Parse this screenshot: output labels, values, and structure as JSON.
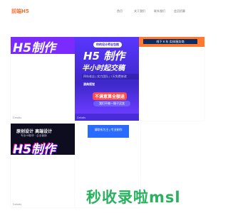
{
  "header": {
    "logo": "前端H5",
    "nav": [
      "首页",
      "关于我们",
      "联系我们",
      "会员招募"
    ]
  },
  "cards": [
    {
      "label": "Details",
      "banner_text": "H5制作"
    },
    {
      "label": "Details",
      "top_pill": "你的设计师全包揽",
      "title": "H5 制作",
      "subtitle": "半小时起交稿",
      "badges": "四年老店 | 实力团队 | 7天免费修改",
      "logo_text": "源典视觉",
      "promo": "不满意算全额退",
      "bottom_pill": "我们不做一锤子买卖"
    },
    {
      "label": "",
      "strip_text": "线下 6 年 实体服务商"
    },
    {
      "label": "Details",
      "title": "原创设计  高端设计",
      "sub": "专业H5制作 · 企业营销",
      "big": "H5制作"
    },
    {
      "label": "",
      "blue_text": "请联系为主 | 专业制作"
    }
  ],
  "watermark": "秒收录啦msl",
  "colors": {
    "logo": "#ff6a2a",
    "purple": "#7b2bff",
    "indigo": "#4a2bd8",
    "orange": "#ff7a2e",
    "navy": "#0b2c63",
    "watermark": "#16aa50"
  }
}
